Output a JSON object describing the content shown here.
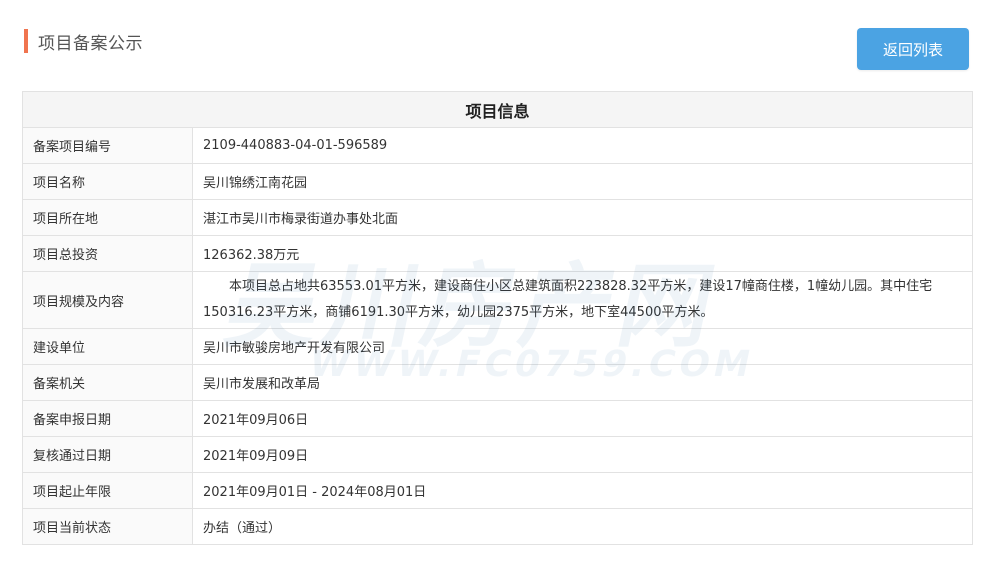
{
  "header": {
    "title": "项目备案公示",
    "accent_color": "#f0744f",
    "back_button_label": "返回列表",
    "back_button_color": "#4ba3e3"
  },
  "table": {
    "heading": "项目信息",
    "rows": [
      {
        "label": "备案项目编号",
        "value": "2109-440883-04-01-596589"
      },
      {
        "label": "项目名称",
        "value": "吴川锦绣江南花园"
      },
      {
        "label": "项目所在地",
        "value": "湛江市吴川市梅录街道办事处北面"
      },
      {
        "label": "项目总投资",
        "value": "126362.38万元"
      },
      {
        "label": "项目规模及内容",
        "value": "本项目总占地共63553.01平方米，建设商住小区总建筑面积223828.32平方米，建设17幢商住楼，1幢幼儿园。其中住宅150316.23平方米，商铺6191.30平方米，幼儿园2375平方米，地下室44500平方米。"
      },
      {
        "label": "建设单位",
        "value": "吴川市敏骏房地产开发有限公司"
      },
      {
        "label": "备案机关",
        "value": "吴川市发展和改革局"
      },
      {
        "label": "备案申报日期",
        "value": "2021年09月06日"
      },
      {
        "label": "复核通过日期",
        "value": "2021年09月09日"
      },
      {
        "label": "项目起止年限",
        "value": "2021年09月01日 - 2024年08月01日"
      },
      {
        "label": "项目当前状态",
        "value": "办结（通过）"
      }
    ]
  },
  "watermark": {
    "main_text": "吴川房产网",
    "sub_text": "WWW.FC0759.COM"
  }
}
